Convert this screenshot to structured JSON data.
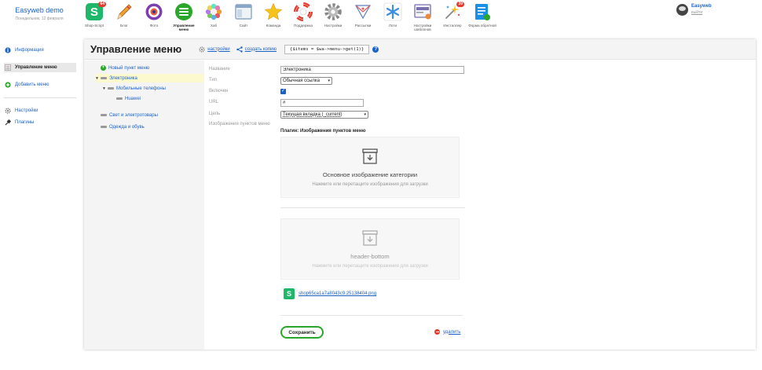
{
  "brand": {
    "name": "Easyweb demo",
    "date": "Понедельник, 12 февраля"
  },
  "apps": [
    {
      "label": "Shop-Script",
      "icon": "shop-script-icon",
      "badge": "64",
      "color": "#1fb86a"
    },
    {
      "label": "Блог",
      "icon": "blog-pencil-icon",
      "badge": "",
      "color": "#f0a030"
    },
    {
      "label": "Фото",
      "icon": "photo-icon",
      "badge": "",
      "color": "#7b3fb0"
    },
    {
      "label": "Управление меню",
      "icon": "menu-icon",
      "badge": "",
      "color": "#2aa62a",
      "active": true
    },
    {
      "label": "Хаб",
      "icon": "hub-icon",
      "badge": "",
      "color": "#e8a030"
    },
    {
      "label": "Сайт",
      "icon": "site-icon",
      "badge": "",
      "color": "#8aa6c6"
    },
    {
      "label": "Команда",
      "icon": "team-star-icon",
      "badge": "",
      "color": "#f6c21c"
    },
    {
      "label": "Поддержка",
      "icon": "support-lifebuoy-icon",
      "badge": "",
      "color": "#e53a2e"
    },
    {
      "label": "Настройки",
      "icon": "settings-gear-icon",
      "badge": "",
      "color": "#888888"
    },
    {
      "label": "Рассылки",
      "icon": "mailer-icon",
      "badge": "",
      "color": "#5a7fc9"
    },
    {
      "label": "Лоти",
      "icon": "snowflake-icon",
      "badge": "",
      "color": "#3a8ee6"
    },
    {
      "label": "Настройки шаблонов",
      "icon": "template-settings-icon",
      "badge": "",
      "color": "#7a6fb0"
    },
    {
      "label": "Инсталлер",
      "icon": "installer-icon",
      "badge": "39",
      "color": "#f6c21c"
    },
    {
      "label": "Форма обратной",
      "icon": "feedback-form-icon",
      "badge": "",
      "color": "#1a8fe6"
    }
  ],
  "user": {
    "name": "Easyweb",
    "logout": "выйти"
  },
  "sidebar": {
    "items": [
      {
        "label": "Информация",
        "icon": "info-icon"
      },
      {
        "label": "Управление меню",
        "icon": "menu-list-icon"
      },
      {
        "label": "Добавить меню",
        "icon": "add-icon"
      }
    ],
    "bottom": [
      {
        "label": "Настройки",
        "icon": "gear-icon"
      },
      {
        "label": "Плагины",
        "icon": "plugin-icon"
      }
    ]
  },
  "header": {
    "title": "Управление меню",
    "settings_link": "настройки",
    "copy_link": "создать копию",
    "code": "{$items = $wa->menu->get(1)}"
  },
  "tree": [
    {
      "label": "Новый пункт меню",
      "kind": "add"
    },
    {
      "label": "Электроника",
      "kind": "node-open",
      "selected": true
    },
    {
      "label": "Мобильные телефоны",
      "kind": "node-open"
    },
    {
      "label": "Huawei",
      "kind": "leaf"
    },
    {
      "label": "Свет и электротовары",
      "kind": "leaf"
    },
    {
      "label": "Одежда и обувь",
      "kind": "leaf"
    }
  ],
  "form": {
    "name_label": "Название",
    "name_value": "Электроника",
    "type_label": "Тип",
    "type_value": "Обычная ссылка",
    "enabled_label": "Включен",
    "enabled_checked": true,
    "url_label": "URL",
    "url_value": "#",
    "target_label": "Цель",
    "target_value": "Текущая вкладка (_current)",
    "images_label": "Изображения пунктов меню"
  },
  "plugin": {
    "title": "Плагин: Изображения пунктов меню",
    "zones": [
      {
        "title": "Основное изображение категории",
        "hint": "Нажмите или перетащите изображения для загрузки"
      },
      {
        "title": "header-bottom",
        "hint": "Нажмите или перетащите изображения для загрузки"
      }
    ],
    "file_name": "shop65ca1a7a8043c9.25138404.png"
  },
  "actions": {
    "save": "Сохранить",
    "delete": "удалить"
  }
}
